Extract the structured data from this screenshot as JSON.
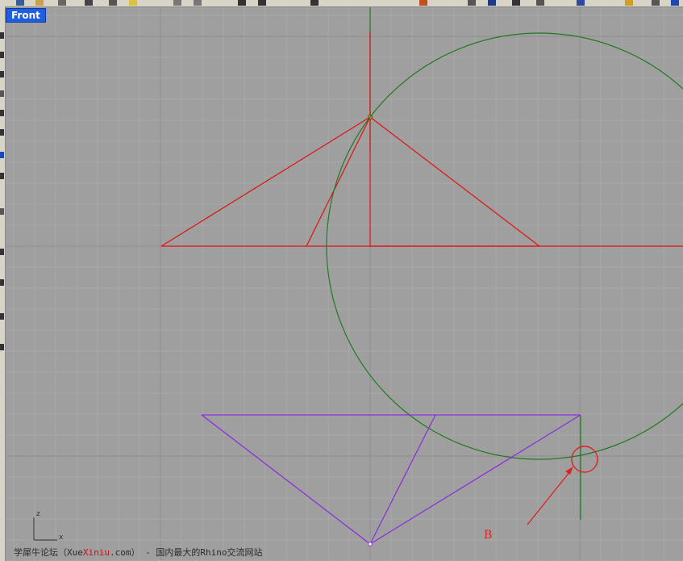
{
  "viewport": {
    "name": "Front"
  },
  "annotation": {
    "label": "B"
  },
  "axes": {
    "z": "z",
    "x": "x"
  },
  "watermark": {
    "prefix": "学犀牛论坛（Xue",
    "highlight": "Xiniu",
    "suffix": ".com） - 国内最大的Rhino交流网站"
  },
  "colors": {
    "background": "#9f9f9f",
    "grid": "#a9a9a9",
    "red_lines": "#e01010",
    "green_lines": "#1f7a1f",
    "purple_lines": "#8a2ae0",
    "label_bg": "#1f5ee0"
  }
}
